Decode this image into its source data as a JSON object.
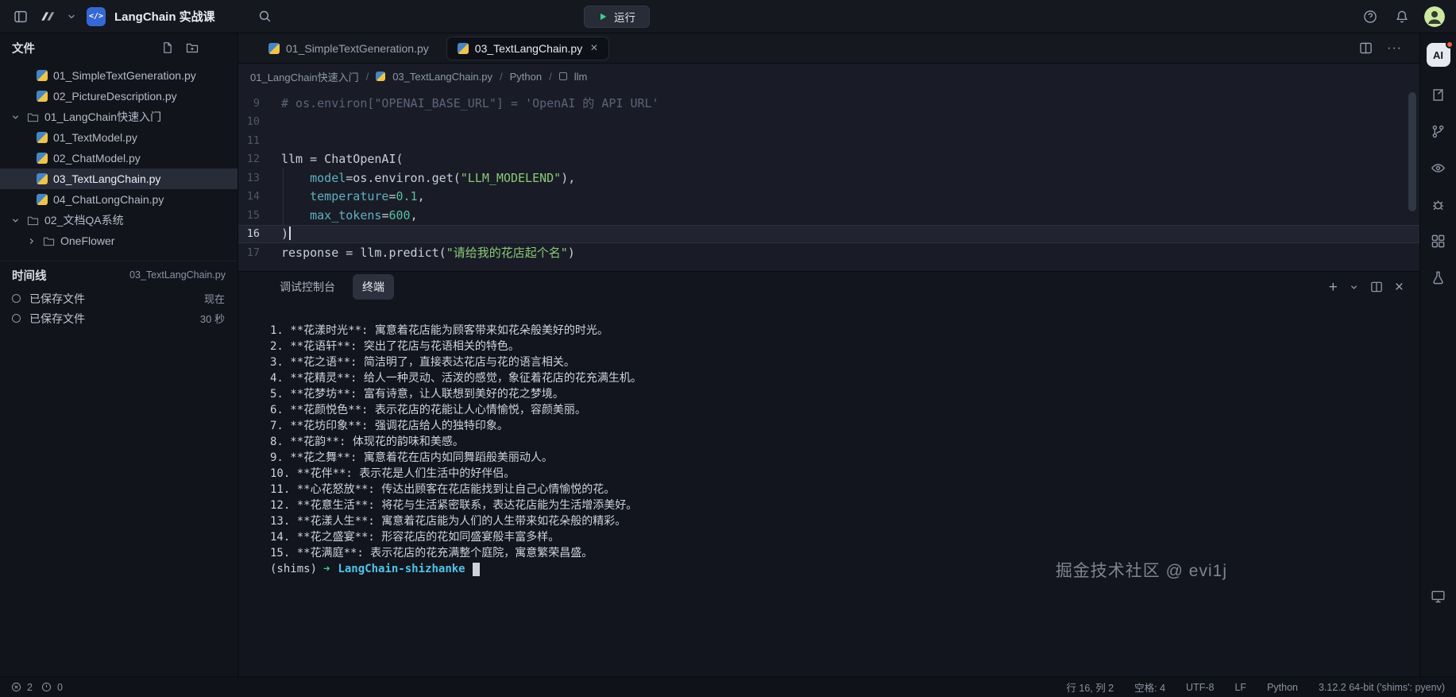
{
  "titlebar": {
    "app_title": "LangChain 实战课",
    "run_label": "运行"
  },
  "explorer": {
    "header": "文件",
    "tree": [
      {
        "name": "01_SimpleTextGeneration.py",
        "type": "pyfile",
        "indent": 1
      },
      {
        "name": "02_PictureDescription.py",
        "type": "pyfile",
        "indent": 1
      },
      {
        "name": "01_LangChain快速入门",
        "type": "folder-open",
        "indent": 0
      },
      {
        "name": "01_TextModel.py",
        "type": "pyfile",
        "indent": 1
      },
      {
        "name": "02_ChatModel.py",
        "type": "pyfile",
        "indent": 1
      },
      {
        "name": "03_TextLangChain.py",
        "type": "pyfile",
        "indent": 1,
        "selected": true
      },
      {
        "name": "04_ChatLongChain.py",
        "type": "pyfile",
        "indent": 1
      },
      {
        "name": "02_文档QA系统",
        "type": "folder-open",
        "indent": 0
      },
      {
        "name": "OneFlower",
        "type": "folder-closed",
        "indent": 1
      }
    ],
    "timeline": {
      "header": "时间线",
      "context_file": "03_TextLangChain.py",
      "entries": [
        {
          "label": "已保存文件",
          "time": "现在"
        },
        {
          "label": "已保存文件",
          "time": "30 秒"
        }
      ]
    }
  },
  "editor": {
    "tabs": [
      {
        "label": "01_SimpleTextGeneration.py",
        "active": false
      },
      {
        "label": "03_TextLangChain.py",
        "active": true
      }
    ],
    "breadcrumb": [
      "01_LangChain快速入门",
      "03_TextLangChain.py",
      "Python",
      "llm"
    ],
    "code": [
      {
        "num": "9",
        "tokens": [
          {
            "t": "# os.environ[\"OPENAI_BASE_URL\"] = 'OpenAI 的 API URL'",
            "c": "comment"
          }
        ]
      },
      {
        "num": "10",
        "tokens": []
      },
      {
        "num": "11",
        "tokens": []
      },
      {
        "num": "12",
        "tokens": [
          {
            "t": "llm = ChatOpenAI(",
            "c": "plain"
          }
        ]
      },
      {
        "num": "13",
        "tokens": [
          {
            "t": "    ",
            "c": "plain"
          },
          {
            "t": "model",
            "c": "param"
          },
          {
            "t": "=os.environ.get(",
            "c": "plain"
          },
          {
            "t": "\"LLM_MODELEND\"",
            "c": "string"
          },
          {
            "t": "),",
            "c": "plain"
          }
        ]
      },
      {
        "num": "14",
        "tokens": [
          {
            "t": "    ",
            "c": "plain"
          },
          {
            "t": "temperature",
            "c": "param"
          },
          {
            "t": "=",
            "c": "plain"
          },
          {
            "t": "0.1",
            "c": "number"
          },
          {
            "t": ",",
            "c": "plain"
          }
        ]
      },
      {
        "num": "15",
        "tokens": [
          {
            "t": "    ",
            "c": "plain"
          },
          {
            "t": "max_tokens",
            "c": "param"
          },
          {
            "t": "=",
            "c": "plain"
          },
          {
            "t": "600",
            "c": "number"
          },
          {
            "t": ",",
            "c": "plain"
          }
        ]
      },
      {
        "num": "16",
        "tokens": [
          {
            "t": ")",
            "c": "plain"
          }
        ],
        "active": true
      },
      {
        "num": "17",
        "tokens": [
          {
            "t": "response = llm.predict(",
            "c": "plain"
          },
          {
            "t": "\"请给我的花店起个名\"",
            "c": "string"
          },
          {
            "t": ")",
            "c": "plain"
          }
        ]
      }
    ]
  },
  "panel": {
    "tabs": [
      {
        "label": "调试控制台",
        "active": false
      },
      {
        "label": "终端",
        "active": true
      }
    ],
    "terminal_lines": [
      "1. **花漾时光**: 寓意着花店能为顾客带来如花朵般美好的时光。",
      "2. **花语轩**: 突出了花店与花语相关的特色。",
      "3. **花之语**: 简洁明了，直接表达花店与花的语言相关。",
      "4. **花精灵**: 给人一种灵动、活泼的感觉，象征着花店的花充满生机。",
      "5. **花梦坊**: 富有诗意，让人联想到美好的花之梦境。",
      "6. **花颜悦色**: 表示花店的花能让人心情愉悦，容颜美丽。",
      "7. **花坊印象**: 强调花店给人的独特印象。",
      "8. **花韵**: 体现花的韵味和美感。",
      "9. **花之舞**: 寓意着花在店内如同舞蹈般美丽动人。",
      "10. **花伴**: 表示花是人们生活中的好伴侣。",
      "11. **心花怒放**: 传达出顾客在花店能找到让自己心情愉悦的花。",
      "12. **花意生活**: 将花与生活紧密联系，表达花店能为生活增添美好。",
      "13. **花漾人生**: 寓意着花店能为人们的人生带来如花朵般的精彩。",
      "14. **花之盛宴**: 形容花店的花如同盛宴般丰富多样。",
      "15. **花满庭**: 表示花店的花充满整个庭院，寓意繁荣昌盛。"
    ],
    "prompt": {
      "venv": "(shims)",
      "arrow": "➜",
      "cwd": "LangChain-shizhanke"
    }
  },
  "watermark": "掘金技术社区 @ evi1j",
  "activitybar": {
    "items": [
      {
        "name": "ai-assistant",
        "label": "AI",
        "active": true
      },
      {
        "name": "file-export"
      },
      {
        "name": "source-control"
      },
      {
        "name": "preview"
      },
      {
        "name": "debug"
      },
      {
        "name": "extensions"
      },
      {
        "name": "tests"
      }
    ],
    "bottom_items": [
      {
        "name": "remote-window"
      }
    ]
  },
  "statusbar": {
    "errors": "2",
    "warnings": "0",
    "items": [
      "行 16, 列 2",
      "空格: 4",
      "UTF-8",
      "LF",
      "Python",
      "3.12.2 64-bit ('shims': pyenv)"
    ]
  },
  "theme": {
    "accent_blue": "#3668d4",
    "string_green": "#8cc878",
    "param_cyan": "#5fb0c1",
    "number_teal": "#58bfa2",
    "run_play_green": "#3ecf8e",
    "terminal_cwd_cyan": "#4fc3e8",
    "ai_badge_dot_orange": "#f2613b",
    "avatar_green": "#cde8a0"
  }
}
